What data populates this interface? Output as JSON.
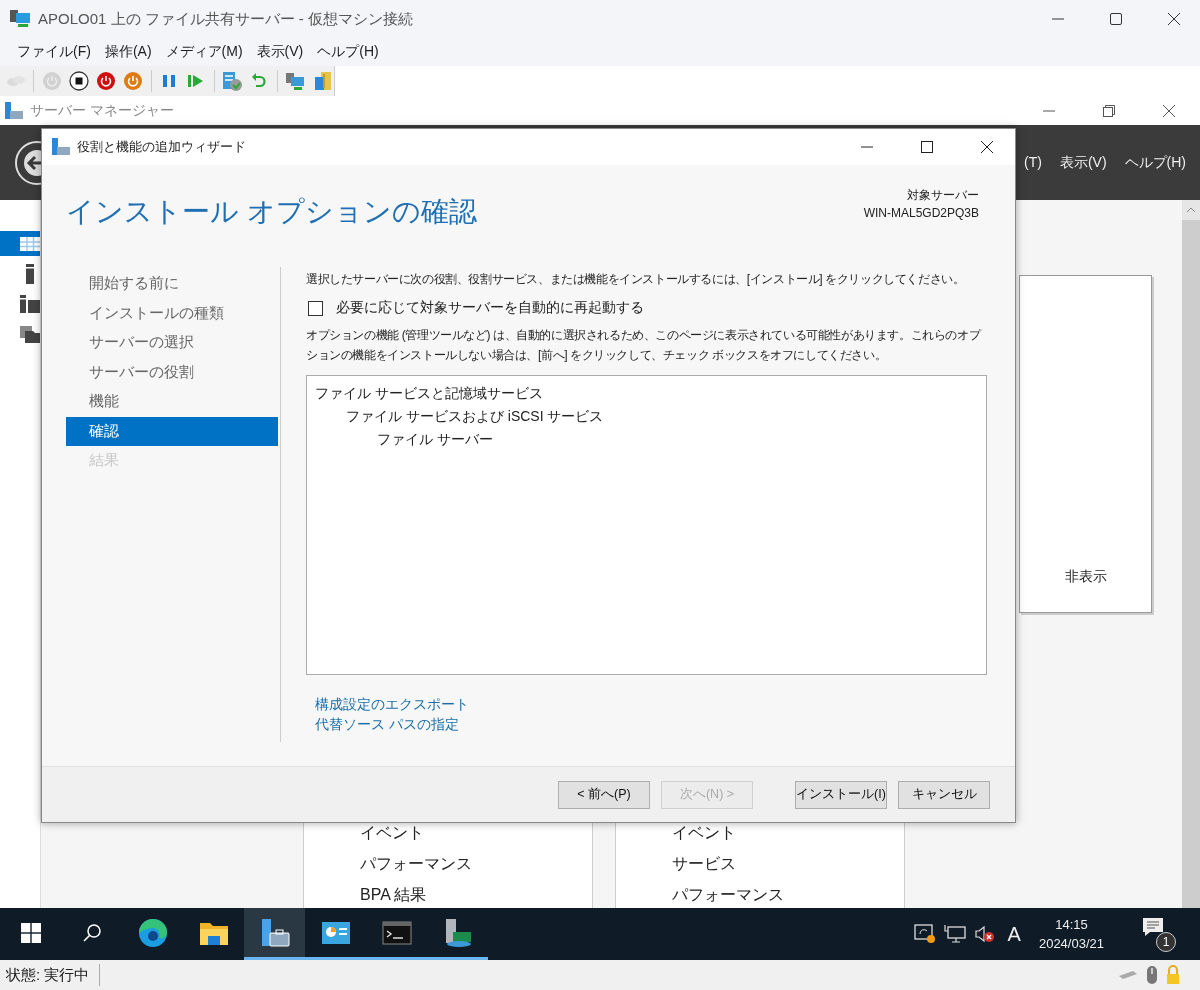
{
  "vm_window": {
    "title": "APOLO01 上の ファイル共有サーバー - 仮想マシン接続",
    "menu": [
      "ファイル(F)",
      "操作(A)",
      "メディア(M)",
      "表示(V)",
      "ヘルプ(H)"
    ],
    "toolbar": [
      [
        {
          "kind": "keys",
          "disabled": true
        }
      ],
      [
        {
          "kind": "start",
          "disabled": true
        },
        {
          "kind": "turn-off",
          "disabled": false
        },
        {
          "kind": "shut-down",
          "disabled": false
        },
        {
          "kind": "save",
          "disabled": false
        }
      ],
      [
        {
          "kind": "pause",
          "disabled": false
        },
        {
          "kind": "reset",
          "disabled": false
        }
      ],
      [
        {
          "kind": "checkpoint",
          "disabled": false
        },
        {
          "kind": "revert",
          "disabled": false
        }
      ],
      [
        {
          "kind": "session",
          "disabled": false
        },
        {
          "kind": "share",
          "disabled": false
        }
      ]
    ]
  },
  "server_manager": {
    "title": "サーバー マネージャー",
    "menu": [
      "(T)",
      "表示(V)",
      "ヘルプ(H)"
    ],
    "nav": [
      {
        "kind": "dashboard",
        "selected": true
      },
      {
        "kind": "local",
        "selected": false
      },
      {
        "kind": "all",
        "selected": false
      },
      {
        "kind": "files",
        "selected": false
      }
    ],
    "panel": {
      "hide_link": "非表示"
    },
    "tiles": [
      {
        "items": [
          "イベント",
          "パフォーマンス",
          "BPA 結果"
        ]
      },
      {
        "items": [
          "イベント",
          "サービス",
          "パフォーマンス"
        ]
      }
    ]
  },
  "wizard": {
    "title": "役割と機能の追加ウィザード",
    "heading": "インストール オプションの確認",
    "target_label": "対象サーバー",
    "target_server": "WIN-MAL5GD2PQ3B",
    "steps": [
      {
        "label": "開始する前に",
        "selected": false,
        "disabled": false
      },
      {
        "label": "インストールの種類",
        "selected": false,
        "disabled": false
      },
      {
        "label": "サーバーの選択",
        "selected": false,
        "disabled": false
      },
      {
        "label": "サーバーの役割",
        "selected": false,
        "disabled": false
      },
      {
        "label": "機能",
        "selected": false,
        "disabled": false
      },
      {
        "label": "確認",
        "selected": true,
        "disabled": false
      },
      {
        "label": "結果",
        "selected": false,
        "disabled": true
      }
    ],
    "instruction": "選択したサーバーに次の役割、役割サービス、または機能をインストールするには、[インストール] をクリックしてください。",
    "restart_option": {
      "label": "必要に応じて対象サーバーを自動的に再起動する",
      "checked": false
    },
    "note": "オプションの機能 (管理ツールなど) は、自動的に選択されるため、このページに表示されている可能性があります。これらのオプションの機能をインストールしない場合は、[前へ] をクリックして、チェック ボックスをオフにしてください。",
    "features": [
      {
        "label": "ファイル サービスと記憶域サービス",
        "children": [
          {
            "label": "ファイル サービスおよび iSCSI サービス",
            "children": [
              {
                "label": "ファイル サーバー"
              }
            ]
          }
        ]
      }
    ],
    "links": [
      "構成設定のエクスポート",
      "代替ソース パスの指定"
    ],
    "buttons": [
      {
        "label": "< 前へ(P)",
        "disabled": false
      },
      {
        "label": "次へ(N) >",
        "disabled": true
      },
      {
        "label": "インストール(I)",
        "disabled": false
      },
      {
        "label": "キャンセル",
        "disabled": false
      }
    ]
  },
  "taskbar": {
    "apps": [
      {
        "kind": "start",
        "running": false,
        "selected": false
      },
      {
        "kind": "search",
        "running": false,
        "selected": false
      },
      {
        "kind": "edge",
        "running": false,
        "selected": false
      },
      {
        "kind": "explorer",
        "running": false,
        "selected": false
      },
      {
        "kind": "server-manager",
        "running": true,
        "selected": true
      },
      {
        "kind": "control-panel",
        "running": true,
        "selected": false
      },
      {
        "kind": "terminal",
        "running": true,
        "selected": false
      },
      {
        "kind": "device",
        "running": true,
        "selected": false
      }
    ],
    "input_indicator": "A",
    "time": "14:15",
    "date": "2024/03/21",
    "notification_count": "1"
  },
  "status_bar": {
    "status": "状態: 実行中"
  }
}
